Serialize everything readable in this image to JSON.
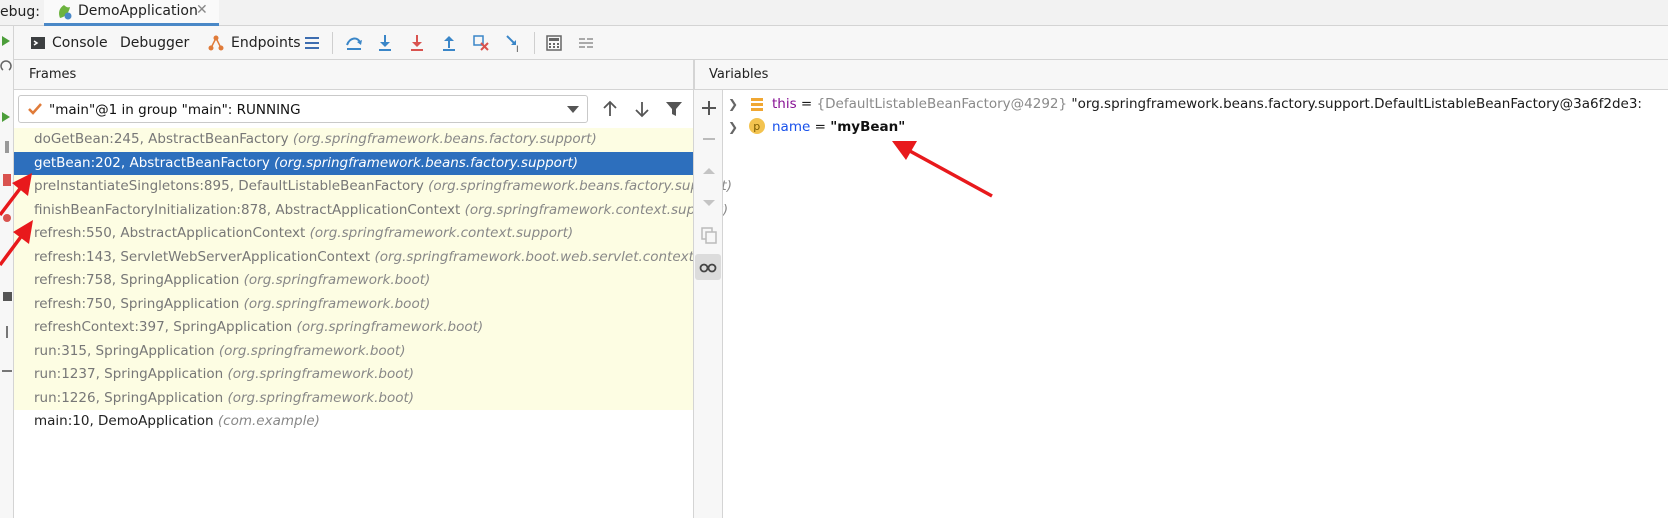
{
  "debug_bar": {
    "label": "ebug:",
    "run_tab_title": "DemoApplication",
    "close_glyph": "✕"
  },
  "toolbar": {
    "tabs": [
      {
        "label": "Console",
        "icon": "console-icon"
      },
      {
        "label": "Debugger",
        "icon": "",
        "active": true
      },
      {
        "label": "Endpoints",
        "icon": "endpoints-icon"
      }
    ],
    "actions": [
      "layout-icon",
      "show-execution-point-icon",
      "step-over-icon",
      "step-into-icon",
      "force-step-into-icon",
      "step-out-icon",
      "drop-frame-icon",
      "run-to-cursor-icon",
      "evaluate-expression-icon",
      "trace-current-stream-icon"
    ]
  },
  "frames_panel": {
    "title": "Frames",
    "thread": "\"main\"@1 in group \"main\": RUNNING",
    "frames": [
      {
        "method": "doGetBean:245, AbstractBeanFactory",
        "pkg": "(org.springframework.beans.factory.support)",
        "kind": "lib"
      },
      {
        "method": "getBean:202, AbstractBeanFactory",
        "pkg": "(org.springframework.beans.factory.support)",
        "kind": "selected"
      },
      {
        "method": "preInstantiateSingletons:895, DefaultListableBeanFactory",
        "pkg": "(org.springframework.beans.factory.support)",
        "kind": "lib"
      },
      {
        "method": "finishBeanFactoryInitialization:878, AbstractApplicationContext",
        "pkg": "(org.springframework.context.support)",
        "kind": "lib"
      },
      {
        "method": "refresh:550, AbstractApplicationContext",
        "pkg": "(org.springframework.context.support)",
        "kind": "lib"
      },
      {
        "method": "refresh:143, ServletWebServerApplicationContext",
        "pkg": "(org.springframework.boot.web.servlet.context)",
        "kind": "lib"
      },
      {
        "method": "refresh:758, SpringApplication",
        "pkg": "(org.springframework.boot)",
        "kind": "lib"
      },
      {
        "method": "refresh:750, SpringApplication",
        "pkg": "(org.springframework.boot)",
        "kind": "lib"
      },
      {
        "method": "refreshContext:397, SpringApplication",
        "pkg": "(org.springframework.boot)",
        "kind": "lib"
      },
      {
        "method": "run:315, SpringApplication",
        "pkg": "(org.springframework.boot)",
        "kind": "lib"
      },
      {
        "method": "run:1237, SpringApplication",
        "pkg": "(org.springframework.boot)",
        "kind": "lib"
      },
      {
        "method": "run:1226, SpringApplication",
        "pkg": "(org.springframework.boot)",
        "kind": "lib"
      },
      {
        "method": "main:10, DemoApplication",
        "pkg": "(com.example)",
        "kind": "app"
      }
    ]
  },
  "variables_panel": {
    "title": "Variables",
    "vars": [
      {
        "name": "this",
        "eq": " = ",
        "type": "{DefaultListableBeanFactory@4292}",
        "value": " \"org.springframework.beans.factory.support.DefaultListableBeanFactory@3a6f2de3:",
        "icon": "field-icon"
      },
      {
        "name": "name",
        "eq": " = ",
        "type": "",
        "value": "\"myBean\"",
        "icon": "parameter-icon",
        "icon_letter": "p"
      }
    ]
  },
  "colors": {
    "selection": "#2d6fbd",
    "library_frame_bg": "#fdfde3",
    "annotation_arrow": "#e8191c"
  }
}
